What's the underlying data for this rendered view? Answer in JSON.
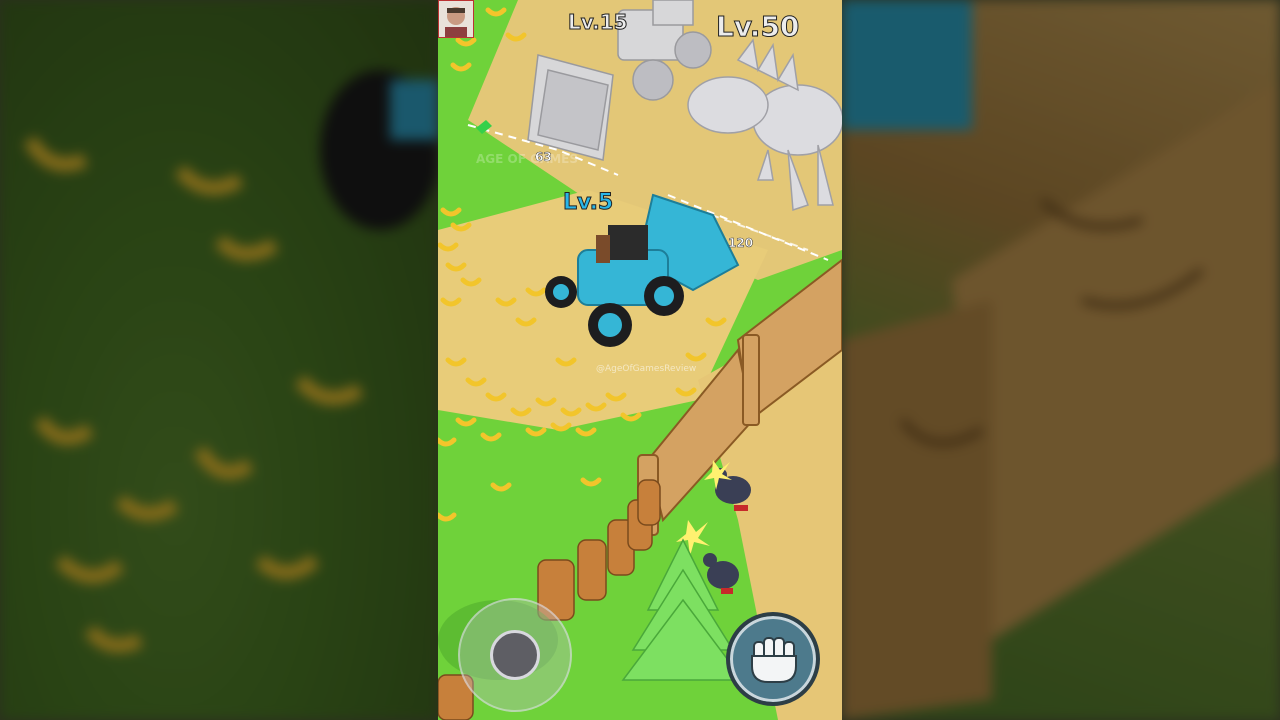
{
  "game": {
    "labels": {
      "loader_level": "Lv.15",
      "dino_level": "Lv.50",
      "player_level": "Lv.5"
    },
    "path_numbers": {
      "near_loader": "63",
      "near_tractor": "120"
    },
    "watermark": "@AgeOfGamesReview",
    "faint_watermark": "AGE OF GAMES",
    "controls": {
      "joystick_icon": "joystick-icon",
      "punch_icon": "fist-icon"
    }
  },
  "colors": {
    "grass": "#6fd23a",
    "dirt": "#e8cc79",
    "player_level_text": "#29b6e8",
    "tractor": "#35b6d6",
    "banana": "#f2c52b"
  }
}
